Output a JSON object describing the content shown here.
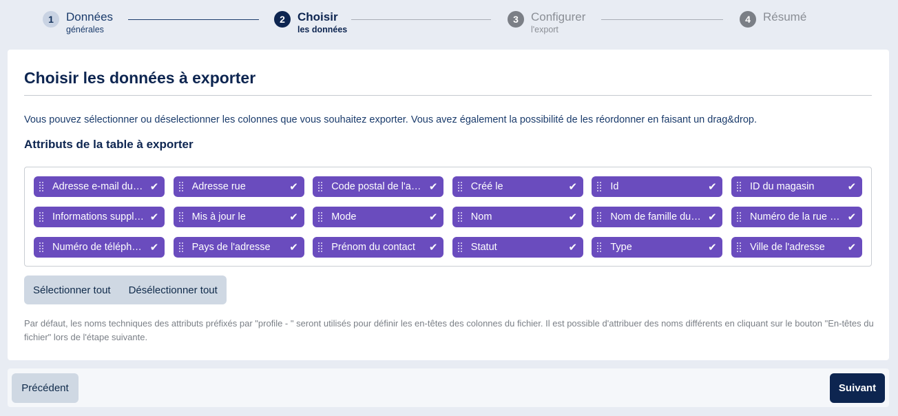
{
  "stepper": {
    "steps": [
      {
        "number": "1",
        "title": "Données",
        "subtitle": "générales",
        "state": "done"
      },
      {
        "number": "2",
        "title": "Choisir",
        "subtitle": "les données",
        "state": "active"
      },
      {
        "number": "3",
        "title": "Configurer",
        "subtitle": "l'export",
        "state": "todo"
      },
      {
        "number": "4",
        "title": "Résumé",
        "subtitle": "",
        "state": "todo"
      }
    ]
  },
  "main": {
    "title": "Choisir les données à exporter",
    "description": "Vous pouvez sélectionner ou déselectionner les colonnes que vous souhaitez exporter. Vous avez également la possibilité de les réordonner en faisant un drag&drop.",
    "section_title": "Attributs de la table à exporter",
    "attributes": [
      {
        "label": "Adresse e-mail du c...",
        "checked": true
      },
      {
        "label": "Adresse rue",
        "checked": true
      },
      {
        "label": "Code postal de l'adr...",
        "checked": true
      },
      {
        "label": "Créé le",
        "checked": true
      },
      {
        "label": "Id",
        "checked": true
      },
      {
        "label": "ID du magasin",
        "checked": true
      },
      {
        "label": "Informations supplé...",
        "checked": true
      },
      {
        "label": "Mis à jour le",
        "checked": true
      },
      {
        "label": "Mode",
        "checked": true
      },
      {
        "label": "Nom",
        "checked": true
      },
      {
        "label": "Nom de famille du c...",
        "checked": true
      },
      {
        "label": "Numéro de la rue d...",
        "checked": true
      },
      {
        "label": "Numéro de téléphone",
        "checked": true
      },
      {
        "label": "Pays de l'adresse",
        "checked": true
      },
      {
        "label": "Prénom du contact",
        "checked": true
      },
      {
        "label": "Statut",
        "checked": true
      },
      {
        "label": "Type",
        "checked": true
      },
      {
        "label": "Ville de l'adresse",
        "checked": true
      }
    ],
    "select_all_label": "Sélectionner tout",
    "deselect_all_label": "Désélectionner tout",
    "note": "Par défaut, les noms techniques des attributs préfixés par \"profile - \" seront utilisés pour définir les en-têtes des colonnes du fichier. Il est possible d'attribuer des noms différents en cliquant sur le bouton \"En-têtes du fichier\" lors de l'étape suivante."
  },
  "footer": {
    "previous_label": "Précédent",
    "next_label": "Suivant"
  },
  "colors": {
    "chip": "#6a4cbe",
    "primary": "#0d2550",
    "secondary_button": "#cfd8e3",
    "background": "#e8ecf3"
  },
  "icons": {
    "check": "check-icon",
    "drag": "drag-handle-icon"
  }
}
